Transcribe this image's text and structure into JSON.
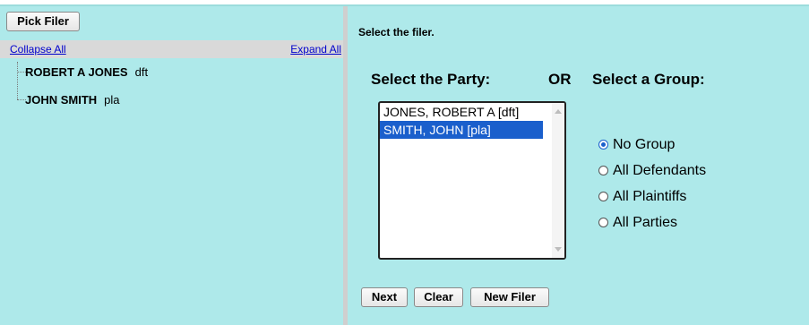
{
  "left_panel": {
    "pick_filer_button": "Pick Filer",
    "collapse_all": "Collapse All",
    "expand_all": "Expand All",
    "tree": [
      {
        "name": "ROBERT A JONES",
        "role": "dft"
      },
      {
        "name": "JOHN SMITH",
        "role": "pla"
      }
    ]
  },
  "right_panel": {
    "instruction": "Select the filer.",
    "party_header": "Select the Party:",
    "or_label": "OR",
    "group_header": "Select a Group:",
    "party_options": [
      {
        "label": "JONES, ROBERT A [dft]",
        "selected": false
      },
      {
        "label": "SMITH, JOHN [pla]",
        "selected": true
      }
    ],
    "group_options": [
      {
        "label": "No Group",
        "checked": true
      },
      {
        "label": "All Defendants",
        "checked": false
      },
      {
        "label": "All Plaintiffs",
        "checked": false
      },
      {
        "label": "All Parties",
        "checked": false
      }
    ],
    "buttons": {
      "next": "Next",
      "clear": "Clear",
      "new_filer": "New Filer"
    }
  },
  "colors": {
    "panel_bg": "#aee9ea",
    "selection": "#1a5fcc",
    "link": "#0000cc"
  }
}
